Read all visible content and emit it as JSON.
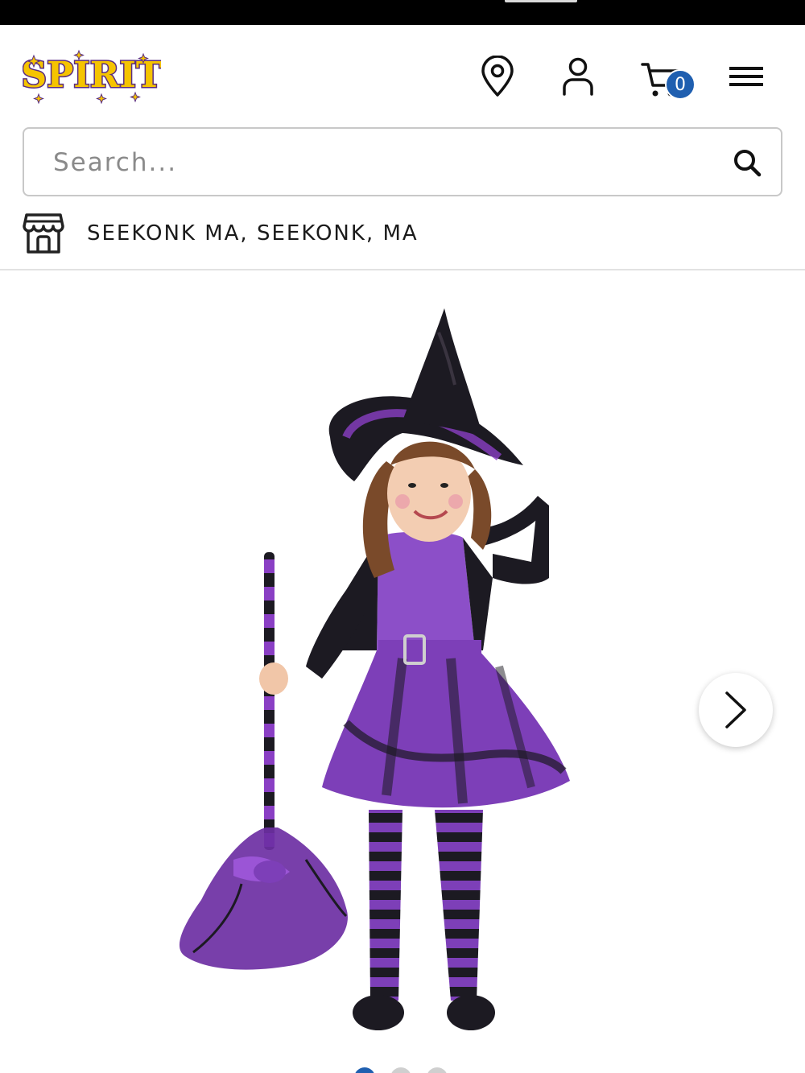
{
  "brand": {
    "logo_text": "SPIRIT"
  },
  "header": {
    "location_icon": "map-pin-icon",
    "account_icon": "user-icon",
    "cart_icon": "shopping-cart-icon",
    "cart_count": "0",
    "menu_icon": "hamburger-menu-icon"
  },
  "search": {
    "placeholder": "Search...",
    "value": "",
    "icon": "search-icon"
  },
  "store": {
    "icon": "storefront-icon",
    "label": "SEEKONK MA, SEEKONK, MA"
  },
  "gallery": {
    "image_alt": "Toddler purple witch costume with hat and broom",
    "next_icon": "chevron-right-icon",
    "slide_count": 3,
    "active_slide": 1
  },
  "colors": {
    "accent": "#1f5fb0",
    "logo_yellow": "#f5c400",
    "logo_purple": "#5a2d82",
    "costume_purple": "#7d3fb8",
    "costume_black": "#1c1a22"
  }
}
